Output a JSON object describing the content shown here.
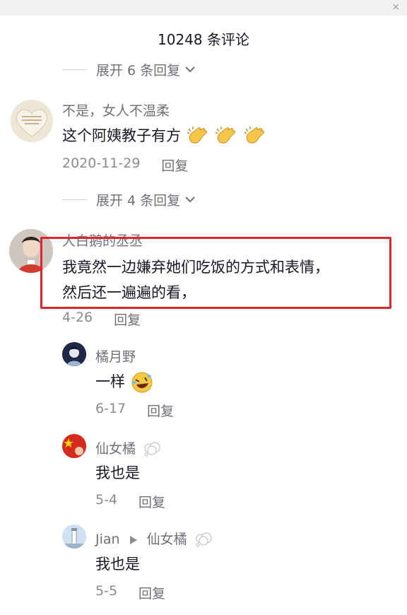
{
  "window": {
    "close_glyph": "×"
  },
  "header": {
    "title": "10248 条评论"
  },
  "expand_rows": [
    {
      "label": "展开 6 条回复"
    },
    {
      "label": "展开 4 条回复"
    }
  ],
  "comments": [
    {
      "username": "不是，女人不温柔",
      "text": "这个阿姨教子有方",
      "emojis": [
        "clapping-hands-emoji",
        "clapping-hands-emoji",
        "clapping-hands-emoji"
      ],
      "date": "2020-11-29",
      "reply_label": "回复",
      "avatar_text": "我不是人间东 不 就想到每个人都喜欢"
    },
    {
      "username": "大白鹅的丞丞",
      "text_line1": "我竟然一边嫌弃她们吃饭的方式和表情，",
      "text_line2": "然后还一遍遍的看，",
      "date": "4-26",
      "reply_label": "回复"
    }
  ],
  "replies": [
    {
      "username": "橘月野",
      "text": "一样",
      "emoji": "rolling-on-floor-laughing-emoji",
      "date": "6-17",
      "reply_label": "回复"
    },
    {
      "username": "仙女橘",
      "badge": "thought-bubble-icon",
      "text": "我也是",
      "date": "5-4",
      "reply_label": "回复"
    },
    {
      "username": "Jian",
      "reply_to": "仙女橘",
      "badge": "thought-bubble-icon",
      "text": "我也是",
      "date": "5-5",
      "reply_label": "回复"
    }
  ],
  "colors": {
    "highlight": "#e0252b",
    "secondary_text": "#6f7077",
    "primary_text": "#161823"
  }
}
